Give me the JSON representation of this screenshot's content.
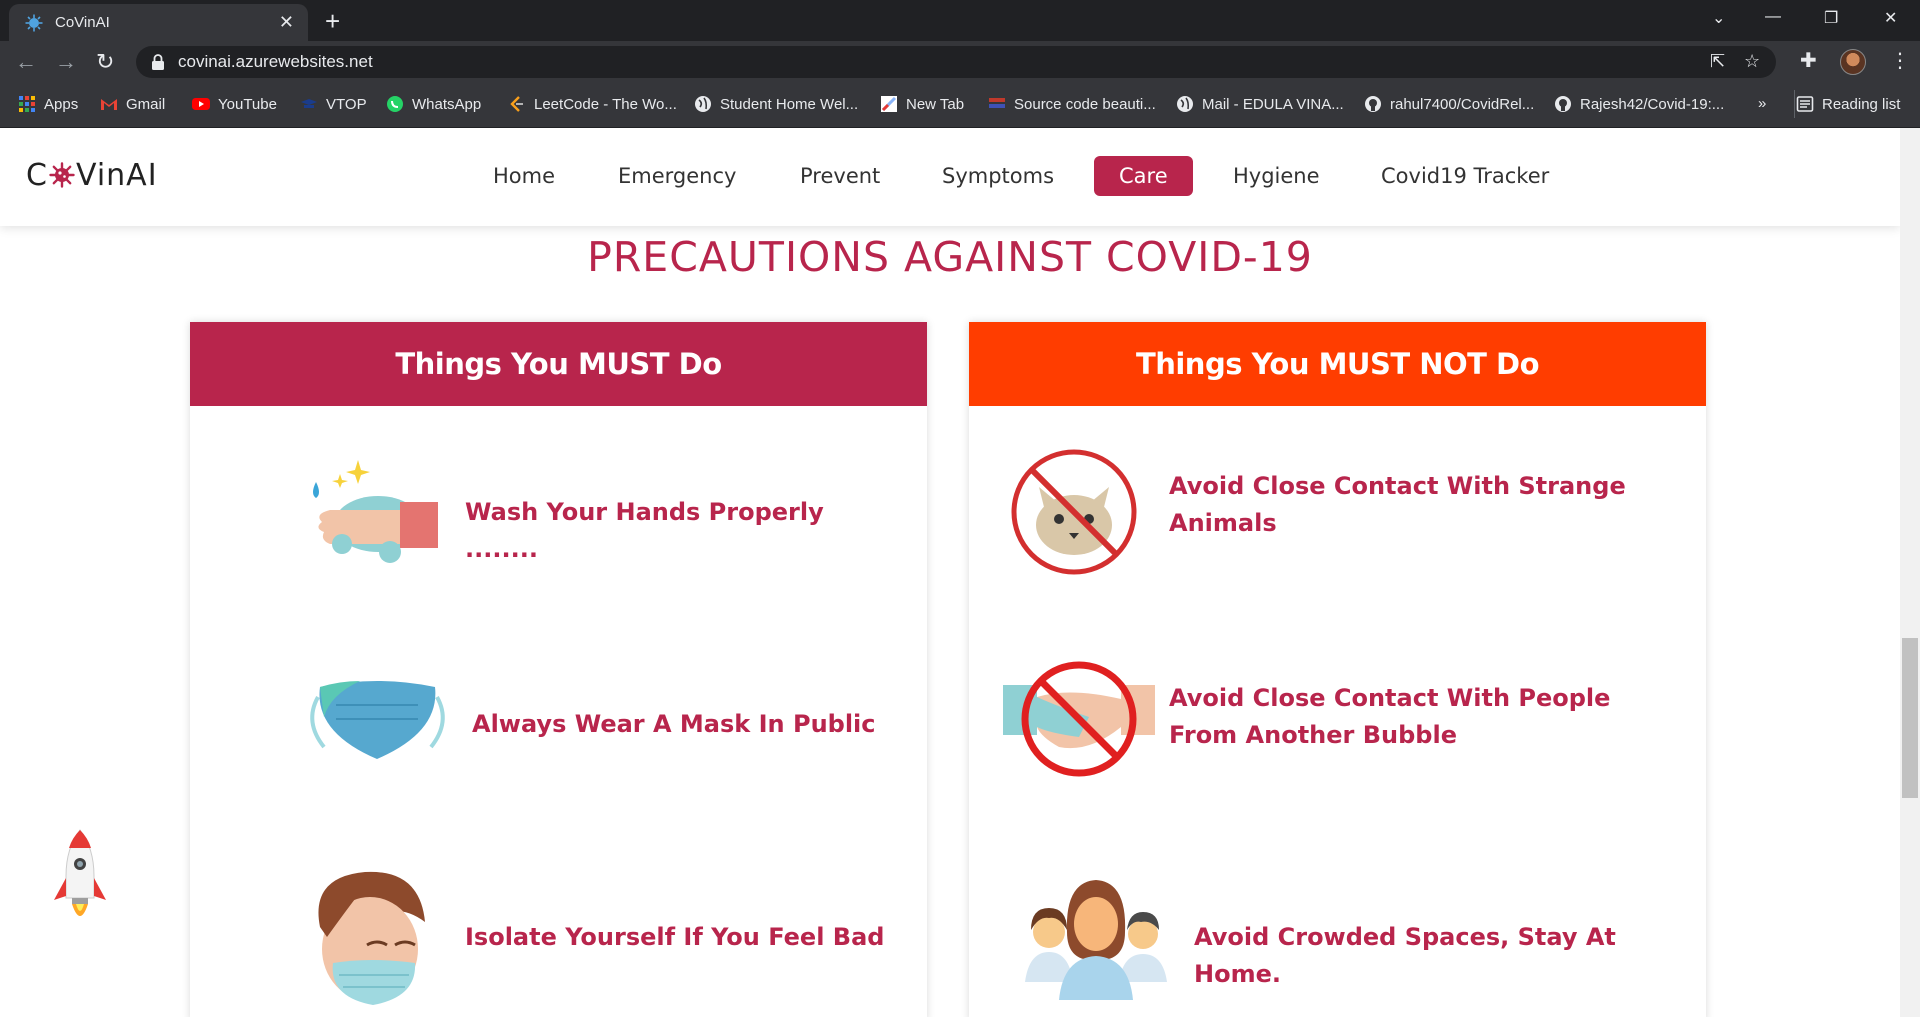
{
  "browser": {
    "tab_title": "CoVinAI",
    "tab_close": "✕",
    "new_tab": "+",
    "url": "covinai.azurewebsites.net",
    "window_controls": {
      "dropdown": "⌄",
      "minimize": "—",
      "restore": "❐",
      "close": "✕"
    },
    "bookmarks": [
      {
        "label": "Apps",
        "icon": "apps-grid-icon",
        "color": "#4285f4"
      },
      {
        "label": "Gmail",
        "icon": "gmail-icon",
        "color": "#ea4335"
      },
      {
        "label": "YouTube",
        "icon": "youtube-icon",
        "color": "#ff0000"
      },
      {
        "label": "VTOP",
        "icon": "vtop-icon",
        "color": "#1a3c8c"
      },
      {
        "label": "WhatsApp",
        "icon": "whatsapp-icon",
        "color": "#25d366"
      },
      {
        "label": "LeetCode - The Wo...",
        "icon": "leetcode-icon",
        "color": "#f89f1b"
      },
      {
        "label": "Student Home Wel...",
        "icon": "globe-icon",
        "color": "#e8eaed"
      },
      {
        "label": "New Tab",
        "icon": "newtab-icon",
        "color": "#8ab4f8"
      },
      {
        "label": "Source code beauti...",
        "icon": "source-code-icon",
        "color": "#c0392b"
      },
      {
        "label": "Mail - EDULA VINA...",
        "icon": "globe-icon",
        "color": "#e8eaed"
      },
      {
        "label": "rahul7400/CovidRel...",
        "icon": "github-icon",
        "color": "#e8eaed"
      },
      {
        "label": "Rajesh42/Covid-19:...",
        "icon": "github-icon",
        "color": "#e8eaed"
      }
    ],
    "overflow": "»",
    "reading_list": "Reading list"
  },
  "site": {
    "logo_left": "C",
    "logo_right": "VinAI",
    "nav": [
      "Home",
      "Emergency",
      "Prevent",
      "Symptoms",
      "Care",
      "Hygiene",
      "Covid19 Tracker"
    ],
    "active_nav": "Care",
    "heading": "PRECAUTIONS AGAINST COVID-19",
    "must_do": {
      "title": "Things You MUST Do",
      "color": "#b8254c",
      "items": [
        "Wash Your Hands Properly ........",
        "Always Wear A Mask In Public",
        "Isolate Yourself If You Feel Bad"
      ]
    },
    "must_not_do": {
      "title": "Things You MUST NOT Do",
      "color": "#ff3d00",
      "items": [
        "Avoid Close Contact With Strange Animals",
        "Avoid Close Contact With People From Another Bubble",
        "Avoid Crowded Spaces, Stay At Home."
      ]
    },
    "accent": "#b8254c"
  }
}
